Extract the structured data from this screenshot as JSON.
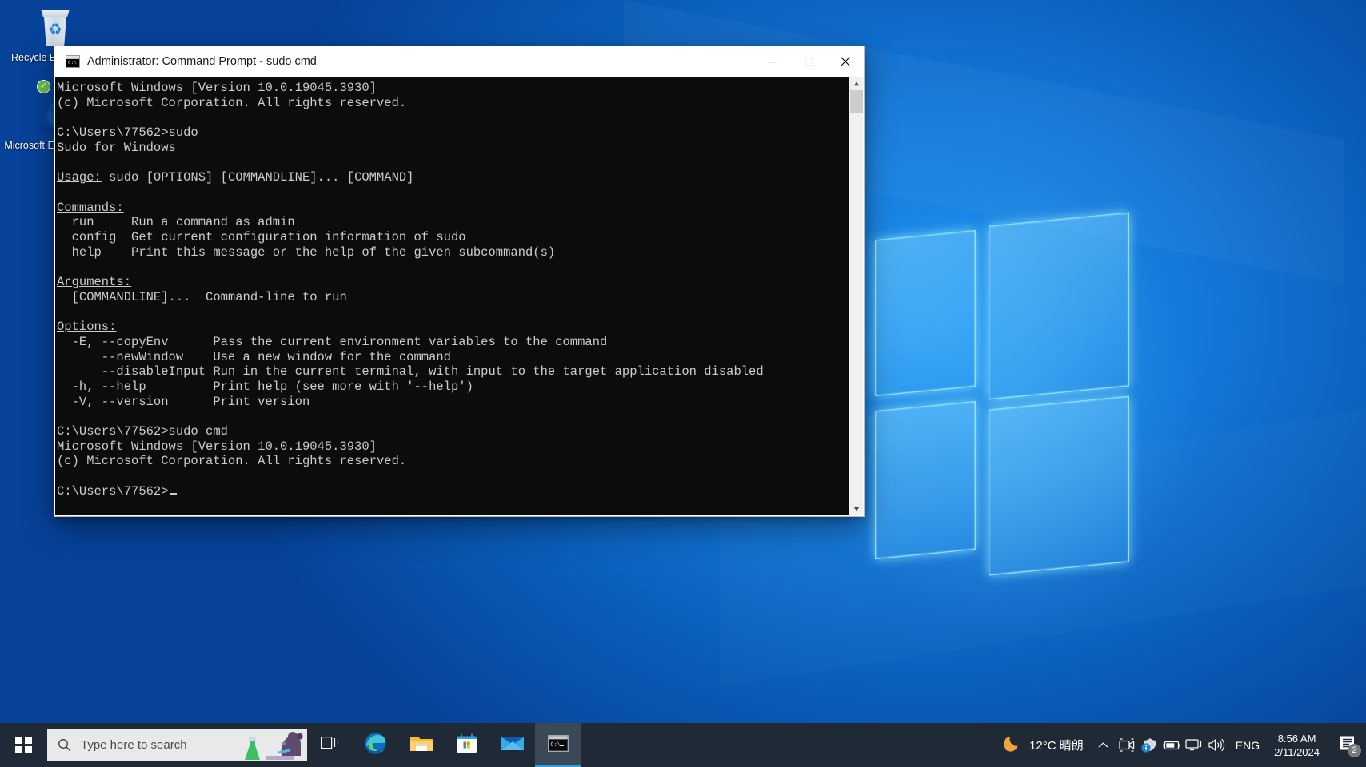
{
  "desktop": {
    "icons": [
      {
        "name": "recycle-bin",
        "label": "Recycle Bin"
      },
      {
        "name": "microsoft-edge",
        "label": "Microsoft Edge"
      }
    ]
  },
  "window": {
    "title": "Administrator: Command Prompt - sudo  cmd",
    "icon": "console-icon",
    "controls": {
      "minimize": "Minimize",
      "maximize": "Maximize",
      "close": "Close"
    },
    "terminal": {
      "lines": [
        "Microsoft Windows [Version 10.0.19045.3930]",
        "(c) Microsoft Corporation. All rights reserved.",
        "",
        "C:\\Users\\77562>sudo",
        "Sudo for Windows",
        "",
        "Usage: sudo [OPTIONS] [COMMANDLINE]... [COMMAND]",
        "",
        "Commands:",
        "  run     Run a command as admin",
        "  config  Get current configuration information of sudo",
        "  help    Print this message or the help of the given subcommand(s)",
        "",
        "Arguments:",
        "  [COMMANDLINE]...  Command-line to run",
        "",
        "Options:",
        "  -E, --copyEnv      Pass the current environment variables to the command",
        "      --newWindow    Use a new window for the command",
        "      --disableInput Run in the current terminal, with input to the target application disabled",
        "  -h, --help         Print help (see more with '--help')",
        "  -V, --version      Print version",
        "",
        "C:\\Users\\77562>sudo cmd",
        "Microsoft Windows [Version 10.0.19045.3930]",
        "(c) Microsoft Corporation. All rights reserved.",
        "",
        "C:\\Users\\77562>"
      ],
      "underlined_headings": [
        "Usage:",
        "Commands:",
        "Arguments:",
        "Options:"
      ],
      "background_color": "#0c0c0c",
      "text_color": "#cccccc"
    }
  },
  "taskbar": {
    "start": "Start",
    "search": {
      "placeholder": "Type here to search",
      "icon": "search-icon"
    },
    "buttons": [
      {
        "name": "task-view",
        "label": "Task View"
      },
      {
        "name": "microsoft-edge",
        "label": "Microsoft Edge"
      },
      {
        "name": "file-explorer",
        "label": "File Explorer"
      },
      {
        "name": "microsoft-store",
        "label": "Microsoft Store"
      },
      {
        "name": "mail",
        "label": "Mail"
      },
      {
        "name": "command-prompt",
        "label": "Command Prompt"
      }
    ],
    "tray": {
      "weather": {
        "temperature": "12°C",
        "condition": "晴朗",
        "icon": "moon-icon"
      },
      "chevron": "Show hidden icons",
      "icons": [
        {
          "name": "meet-now-icon",
          "label": "Meet Now"
        },
        {
          "name": "security-icon",
          "label": "Windows Security"
        },
        {
          "name": "battery-icon",
          "label": "Battery"
        },
        {
          "name": "network-icon",
          "label": "Network"
        },
        {
          "name": "volume-icon",
          "label": "Volume"
        }
      ],
      "language": "ENG",
      "clock": {
        "time": "8:56 AM",
        "date": "2/11/2024"
      },
      "notifications": {
        "icon": "notification-icon",
        "count": "2"
      }
    }
  },
  "colors": {
    "accent": "#2f9fe0",
    "taskbar": "#1f2a36",
    "terminal_bg": "#0c0c0c",
    "close_hover": "#e81123"
  }
}
